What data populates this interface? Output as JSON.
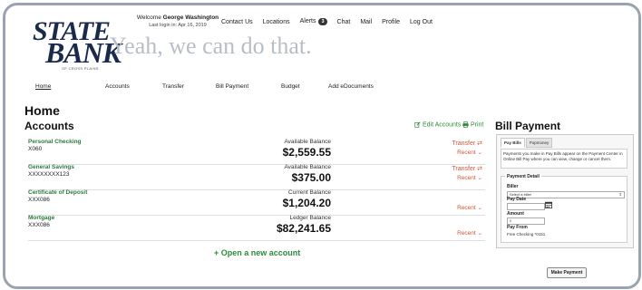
{
  "brand": {
    "logo_line1": "STATE",
    "logo_line2": "BANK",
    "logo_tagline": "OF CROSS PLAINS",
    "slogan": "Yeah, we can do that."
  },
  "header": {
    "welcome_prefix": "Welcome",
    "user_name": "George Washington",
    "last_login": "Last login in: Apr 16, 2019",
    "links": {
      "contact": "Contact Us",
      "locations": "Locations",
      "alerts": "Alerts",
      "alerts_count": "3",
      "chat": "Chat",
      "mail": "Mail",
      "profile": "Profile",
      "logout": "Log Out"
    }
  },
  "nav": {
    "home": "Home",
    "accounts": "Accounts",
    "transfer": "Transfer",
    "bill_payment": "Bill Payment",
    "budget": "Budget",
    "edocuments": "Add eDocuments"
  },
  "page": {
    "title": "Home",
    "accounts_title": "Accounts",
    "edit_accounts": "Edit Accounts",
    "print": "Print",
    "open_account": "+ Open a new account"
  },
  "accounts": [
    {
      "name": "Personal Checking",
      "number": "X060",
      "balance_label": "Available Balance",
      "balance": "$2,559.55",
      "transfer": "Transfer",
      "recent": "Recent"
    },
    {
      "name": "General Savings",
      "number": "XXXXXXXX123",
      "balance_label": "Available Balance",
      "balance": "$375.00",
      "transfer": "Transfer",
      "recent": "Recent"
    },
    {
      "name": "Certificate of Deposit",
      "number": "XXX086",
      "balance_label": "Current Balance",
      "balance": "$1,204.20",
      "recent": "Recent"
    },
    {
      "name": "Mortgage",
      "number": "XXX086",
      "balance_label": "Ledger Balance",
      "balance": "$82,241.65",
      "recent": "Recent"
    }
  ],
  "bill_payment": {
    "title": "Bill Payment",
    "tab_pay_bills": "Pay Bills",
    "tab_popmoney": "Popmoney",
    "info": "Payments you make in Pay Bills appear on the Payment Center in Online Bill Pay where you can view, change or cancel them.",
    "detail_title": "Payment Detail",
    "biller_label": "Biller",
    "biller_value": "Select a biller",
    "pay_date_label": "Pay Date",
    "amount_label": "Amount",
    "amount_placeholder": "0",
    "pay_from_label": "Pay From",
    "pay_from_value": "Free Checking *0151",
    "make_payment": "Make Payment"
  },
  "colors": {
    "brand_navy": "#1b2a4a",
    "link_green": "#2c8a3b",
    "action_orange": "#d2573a",
    "frame_border": "#9aa4b0"
  }
}
